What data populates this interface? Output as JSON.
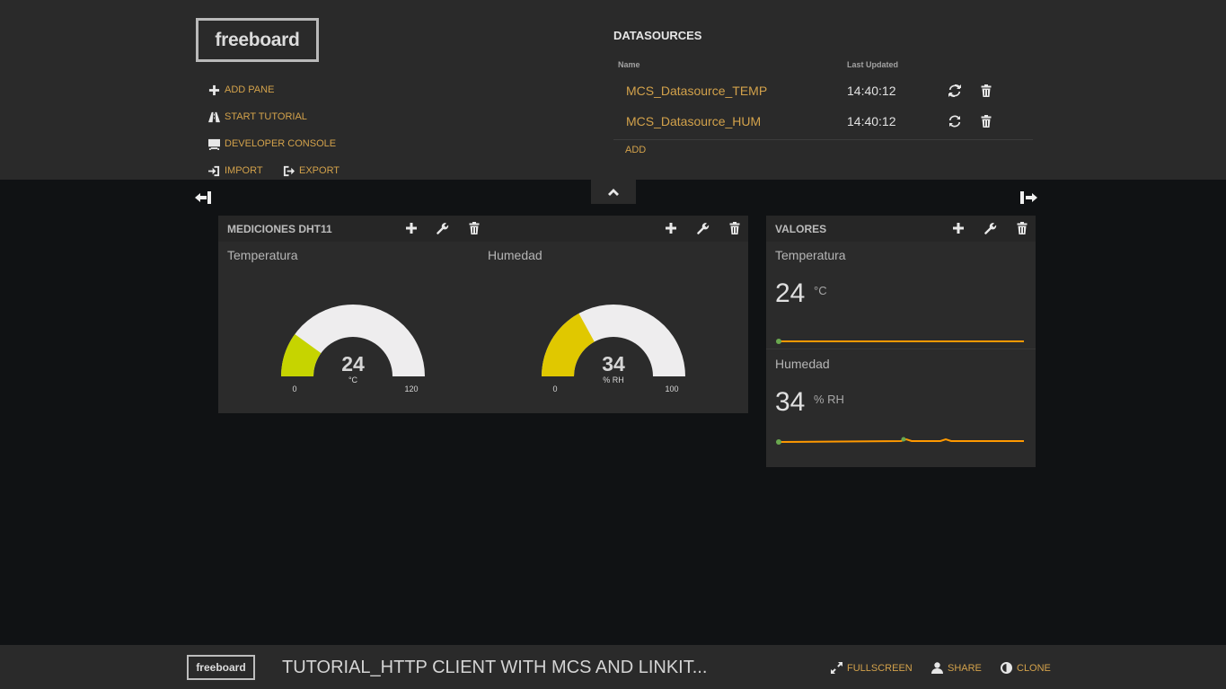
{
  "app": {
    "logo": "freeboard"
  },
  "menu": {
    "add_pane": "ADD PANE",
    "start_tutorial": "START TUTORIAL",
    "developer_console": "DEVELOPER CONSOLE",
    "import": "IMPORT",
    "export": "EXPORT"
  },
  "datasources": {
    "title": "DATASOURCES",
    "col_name": "Name",
    "col_updated": "Last Updated",
    "rows": [
      {
        "name": "MCS_Datasource_TEMP",
        "updated": "14:40:12"
      },
      {
        "name": "MCS_Datasource_HUM",
        "updated": "14:40:12"
      }
    ],
    "add_label": "ADD"
  },
  "panes": [
    {
      "title": "MEDICIONES DHT11",
      "widgets": [
        {
          "type": "gauge",
          "title": "Temperatura",
          "value": "24",
          "units": "°C",
          "min": "0",
          "max": "120",
          "fill": 0.2,
          "color": "#c6d400"
        },
        {
          "type": "gauge",
          "title": "Humedad",
          "value": "34",
          "units": "% RH",
          "min": "0",
          "max": "100",
          "fill": 0.34,
          "color": "#e0c800"
        }
      ]
    },
    {
      "title": "VALORES",
      "widgets": [
        {
          "type": "text",
          "title": "Temperatura",
          "value": "24",
          "units": "°C"
        },
        {
          "type": "text",
          "title": "Humedad",
          "value": "34",
          "units": "% RH"
        }
      ]
    }
  ],
  "footer": {
    "logo": "freeboard",
    "title": "TUTORIAL_HTTP CLIENT WITH MCS AND LINKIT...",
    "fullscreen": "FULLSCREEN",
    "share": "SHARE",
    "clone": "CLONE"
  },
  "colors": {
    "accent": "#d3a24b",
    "sparkline": "#ff9900",
    "spark_dot": "#6aa84f"
  }
}
